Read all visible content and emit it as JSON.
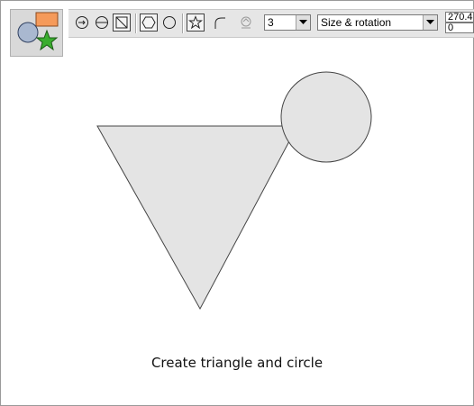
{
  "toolbar": {
    "sides_value": "3",
    "mode_value": "Size & rotation",
    "field_top": "270.4",
    "field_bottom": "0"
  },
  "icons": {
    "tool": "shape-editor-tool-icon",
    "buttons": [
      "circle-arrow-icon",
      "circle-line-icon",
      "square-diagonal-icon",
      "hexagon-icon",
      "circle-icon",
      "star-icon",
      "curve-icon",
      "stepper-icon"
    ]
  },
  "colors": {
    "shape_fill": "#e4e4e4",
    "shape_stroke": "#444444",
    "toolbar_bg": "#e6e6e6"
  },
  "caption": "Create triangle and circle"
}
